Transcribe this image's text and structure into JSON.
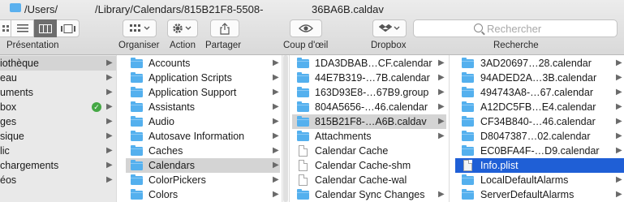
{
  "window": {
    "path_seg1": "/Users/",
    "path_seg2": "/Library/Calendars/815B21F8-5508-",
    "path_seg3": "36BA6B.caldav"
  },
  "toolbar": {
    "presentation_label": "Présentation",
    "organiser_label": "Organiser",
    "action_label": "Action",
    "partager_label": "Partager",
    "coupdoeil_label": "Coup d'œil",
    "dropbox_label": "Dropbox",
    "recherche_label": "Recherche",
    "search_placeholder": "Rechercher"
  },
  "sidebar": {
    "items": [
      {
        "label": "iothèque",
        "selected": true
      },
      {
        "label": "eau"
      },
      {
        "label": "uments"
      },
      {
        "label": "box",
        "badge": "✓"
      },
      {
        "label": "ges"
      },
      {
        "label": "sique"
      },
      {
        "label": "lic"
      },
      {
        "label": "chargements"
      },
      {
        "label": "éos"
      }
    ]
  },
  "library_column": {
    "items": [
      {
        "label": "Accounts"
      },
      {
        "label": "Application Scripts"
      },
      {
        "label": "Application Support"
      },
      {
        "label": "Assistants"
      },
      {
        "label": "Audio"
      },
      {
        "label": "Autosave Information"
      },
      {
        "label": "Caches"
      },
      {
        "label": "Calendars",
        "selected": true
      },
      {
        "label": "ColorPickers"
      },
      {
        "label": "Colors"
      }
    ]
  },
  "calendars_column": {
    "items": [
      {
        "label": "1DA3DBAB…CF.calendar",
        "kind": "folder"
      },
      {
        "label": "44E7B319-…7B.calendar",
        "kind": "folder"
      },
      {
        "label": "163D93E8-…67B9.group",
        "kind": "folder"
      },
      {
        "label": "804A5656-…46.calendar",
        "kind": "folder"
      },
      {
        "label": "815B21F8-…A6B.caldav",
        "kind": "folder",
        "selected": true
      },
      {
        "label": "Attachments",
        "kind": "folder"
      },
      {
        "label": "Calendar Cache",
        "kind": "doc"
      },
      {
        "label": "Calendar Cache-shm",
        "kind": "doc"
      },
      {
        "label": "Calendar Cache-wal",
        "kind": "doc"
      },
      {
        "label": "Calendar Sync Changes",
        "kind": "folder"
      }
    ]
  },
  "caldav_column": {
    "items": [
      {
        "label": "3AD20697…28.calendar",
        "kind": "folder"
      },
      {
        "label": "94ADED2A…3B.calendar",
        "kind": "folder"
      },
      {
        "label": "494743A8-…67.calendar",
        "kind": "folder"
      },
      {
        "label": "A12DC5FB…E4.calendar",
        "kind": "folder"
      },
      {
        "label": "CF34B840-…46.calendar",
        "kind": "folder"
      },
      {
        "label": "D8047387…02.calendar",
        "kind": "folder"
      },
      {
        "label": "EC0BFA4F-…D9.calendar",
        "kind": "folder"
      },
      {
        "label": "Info.plist",
        "kind": "doc",
        "selected": true
      },
      {
        "label": "LocalDefaultAlarms",
        "kind": "folder"
      },
      {
        "label": "ServerDefaultAlarms",
        "kind": "folder"
      }
    ]
  },
  "colors": {
    "selection_blue": "#1f5fd6",
    "selection_grey": "#d4d4d4",
    "folder_blue": "#54b0ee",
    "sync_green": "#45a845"
  }
}
